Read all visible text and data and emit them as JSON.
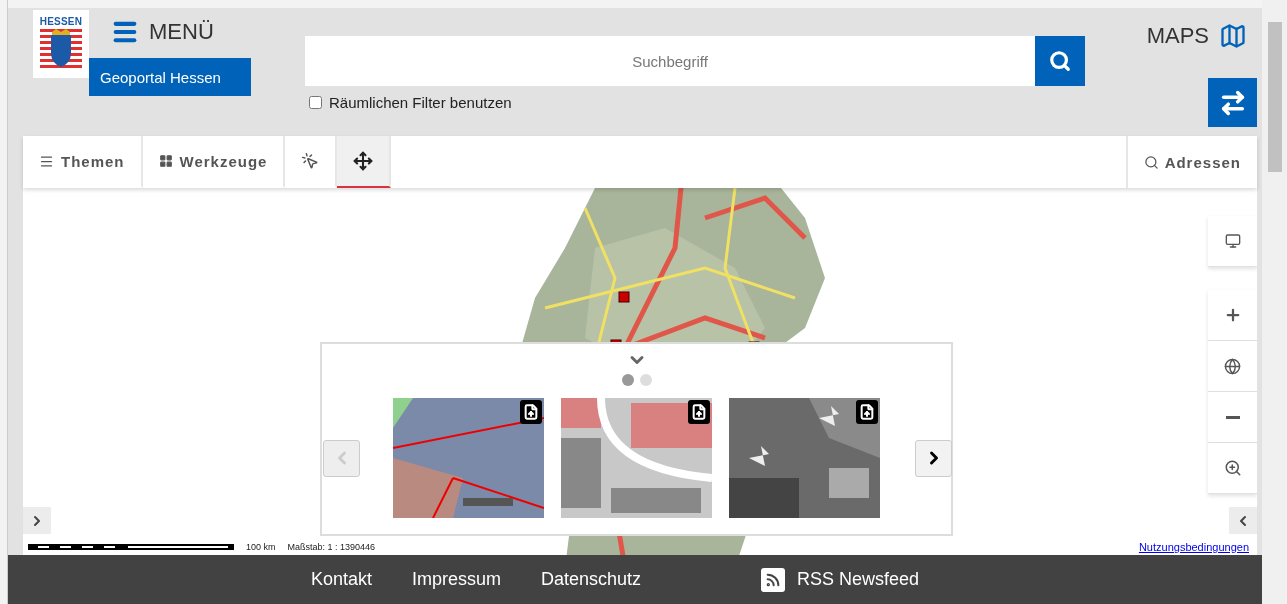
{
  "header": {
    "logo_text": "HESSEN",
    "menu_label": "MENÜ",
    "brand": "Geoportal Hessen",
    "search": {
      "placeholder": "Suchbegriff"
    },
    "spatial_filter": {
      "label": "Räumlichen Filter benutzen",
      "checked": false
    },
    "maps_label": "MAPS"
  },
  "toolbar": {
    "items": [
      {
        "kind": "text",
        "label": "Themen",
        "selected": false
      },
      {
        "kind": "text",
        "label": "Werkzeuge",
        "selected": false
      },
      {
        "kind": "icon",
        "selected": false
      },
      {
        "kind": "icon",
        "selected": true
      }
    ],
    "address_label": "Adressen"
  },
  "map": {
    "kind": "picture",
    "scale_distance": "100 km",
    "scale_ratio": "Maßstab: 1 : 1390446",
    "terms_link": "Nutzungsbedingungen"
  },
  "carousel": {
    "dots": [
      {
        "selected": true
      },
      {
        "selected": false
      }
    ],
    "prev_disabled": true,
    "next_disabled": false
  },
  "footer": {
    "links": [
      {
        "kind": "text",
        "label": "Kontakt"
      },
      {
        "kind": "text",
        "label": "Impressum"
      },
      {
        "kind": "text",
        "label": "Datenschutz"
      },
      {
        "kind": "rss",
        "label": "RSS Newsfeed"
      }
    ]
  }
}
